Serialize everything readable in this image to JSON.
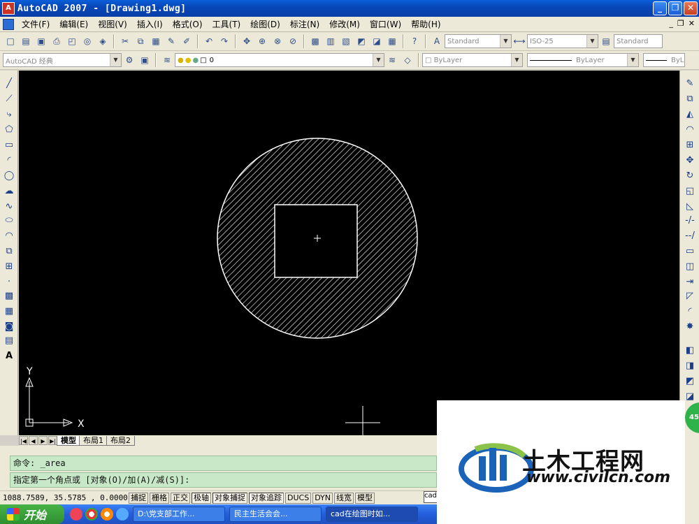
{
  "window": {
    "title": "AutoCAD 2007 - [Drawing1.dwg]",
    "buttons": [
      "_",
      "❐",
      "✕"
    ]
  },
  "menu": {
    "items": [
      "文件(F)",
      "编辑(E)",
      "视图(V)",
      "插入(I)",
      "格式(O)",
      "工具(T)",
      "绘图(D)",
      "标注(N)",
      "修改(M)",
      "窗口(W)",
      "帮助(H)"
    ],
    "doc_buttons": [
      "_",
      "❐",
      "✕"
    ]
  },
  "toolbar1": {
    "text_style": "Standard",
    "dim_style": "ISO-25",
    "table_style": "Standard"
  },
  "toolbar2": {
    "workspace": "AutoCAD 经典",
    "layer": "0",
    "color": "ByLayer",
    "linetype": "ByLayer",
    "lineweight": "ByL"
  },
  "tabs": {
    "items": [
      "模型",
      "布局1",
      "布局2"
    ]
  },
  "command": {
    "line1": "命令: _area",
    "line2": "指定第一个角点或 [对象(O)/加(A)/减(S)]:"
  },
  "status": {
    "coords": "1088.7589, 35.5785 , 0.0000",
    "buttons": [
      "捕捉",
      "栅格",
      "正交",
      "极轴",
      "对象捕捉",
      "对象追踪",
      "DUCS",
      "DYN",
      "线宽",
      "模型"
    ],
    "field": "cad"
  },
  "taskbar": {
    "start": "开始",
    "tasks": [
      "D:\\党支部工作...",
      "民主生活会会...",
      "cad在绘图时如..."
    ]
  },
  "ucs": {
    "x_label": "X",
    "y_label": "Y"
  },
  "badge": "45",
  "watermark": {
    "cn": "土木工程网",
    "url": "www.civilcn.com"
  },
  "colors": {
    "hatch": "#ffffff",
    "background": "#000000",
    "cmdline": "#c7e9c7"
  }
}
